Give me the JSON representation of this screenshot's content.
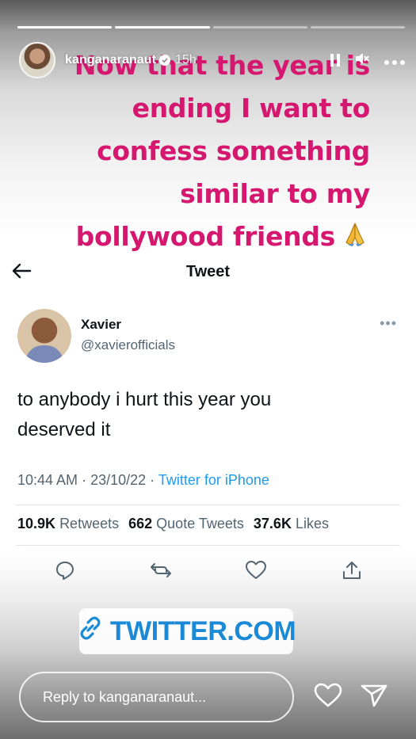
{
  "story": {
    "username": "kanganaranaut",
    "time": "15h",
    "caption_lines": [
      "Now that the year is",
      "ending I want to",
      "confess something",
      "similar to my",
      "bollywood friends"
    ],
    "caption_emoji": "🙏",
    "progress_segments": 4
  },
  "tweet": {
    "header_title": "Tweet",
    "author_name": "Xavier",
    "author_handle": "@xavierofficials",
    "text_line1": "to anybody i hurt this year you",
    "text_line2": "deserved it",
    "time": "10:44 AM",
    "date": "23/10/22",
    "source": "Twitter for iPhone",
    "retweets_count": "10.9K",
    "retweets_label": "Retweets",
    "quotes_count": "662",
    "quotes_label": "Quote Tweets",
    "likes_count": "37.6K",
    "likes_label": "Likes"
  },
  "link": {
    "label": "TWITTER.COM"
  },
  "reply": {
    "placeholder": "Reply to kanganaranaut..."
  },
  "colors": {
    "caption": "#d6176f",
    "link": "#1b8ad6",
    "twitter_blue": "#1d9bf0"
  }
}
